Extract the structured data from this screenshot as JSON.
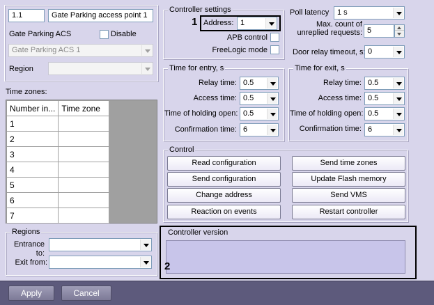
{
  "top": {
    "id_value": "1.1",
    "name_value": "Gate Parking access point 1",
    "parent_label": "Gate Parking ACS",
    "disable_label": "Disable",
    "parent_select": "Gate Parking ACS 1",
    "region_label": "Region",
    "region_select": ""
  },
  "timezones": {
    "label": "Time zones:",
    "columns": [
      "Number in...",
      "Time zone"
    ],
    "rows": [
      {
        "number": "1",
        "zone": ""
      },
      {
        "number": "2",
        "zone": ""
      },
      {
        "number": "3",
        "zone": ""
      },
      {
        "number": "4",
        "zone": ""
      },
      {
        "number": "5",
        "zone": ""
      },
      {
        "number": "6",
        "zone": ""
      },
      {
        "number": "7",
        "zone": ""
      }
    ]
  },
  "regions": {
    "title": "Regions",
    "entrance_label": "Entrance to:",
    "entrance_value": "",
    "exit_label": "Exit from:",
    "exit_value": ""
  },
  "controller": {
    "title": "Controller settings",
    "address_label": "Address:",
    "address_value": "1",
    "apb_label": "APB control",
    "freelogic_label": "FreeLogic mode",
    "callout_1": "1"
  },
  "poll": {
    "latency_label": "Poll latency",
    "latency_value": "1 s",
    "max_count_label": "Max. count of unreplied requests:",
    "max_count_value": "5",
    "door_relay_label": "Door relay timeout, s:",
    "door_relay_value": "0"
  },
  "entry": {
    "title": "Time for entry, s",
    "relay_label": "Relay time:",
    "relay_value": "0.5",
    "access_label": "Access time:",
    "access_value": "0.5",
    "holding_label": "Time of holding open:",
    "holding_value": "0.5",
    "confirm_label": "Confirmation time:",
    "confirm_value": "6"
  },
  "exit": {
    "title": "Time for exit, s",
    "relay_label": "Relay time:",
    "relay_value": "0.5",
    "access_label": "Access time:",
    "access_value": "0.5",
    "holding_label": "Time of holding open:",
    "holding_value": "0.5",
    "confirm_label": "Confirmation time:",
    "confirm_value": "6"
  },
  "control": {
    "title": "Control",
    "read_config": "Read configuration",
    "send_time_zones": "Send time zones",
    "send_config": "Send configuration",
    "update_flash": "Update Flash memory",
    "change_address": "Change address",
    "send_vms": "Send VMS",
    "reaction_events": "Reaction on events",
    "restart_controller": "Restart controller"
  },
  "version": {
    "title": "Controller version",
    "value": "",
    "callout_2": "2"
  },
  "footer": {
    "apply": "Apply",
    "cancel": "Cancel"
  }
}
